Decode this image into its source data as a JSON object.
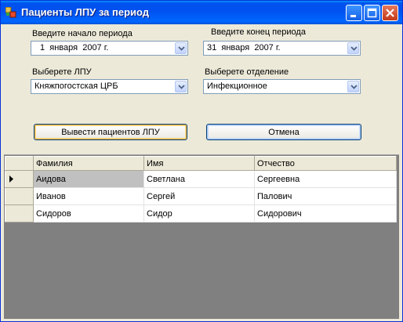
{
  "window": {
    "title": "Пациенты ЛПУ за период"
  },
  "form": {
    "start_label": "Введите начало периода",
    "start_day": "1",
    "start_month": "января",
    "start_year": "2007 г.",
    "end_label": "Введите конец периода",
    "end_day": "31",
    "end_month": "января",
    "end_year": "2007 г.",
    "lpu_label": "Выберете ЛПУ",
    "lpu_value": "Княжпогостская ЦРБ",
    "dept_label": "Выберете отделение",
    "dept_value": "Инфекционное",
    "submit_label": "Вывести пациентов ЛПУ",
    "cancel_label": "Отмена"
  },
  "grid": {
    "columns": [
      "Фамилия",
      "Имя",
      "Отчество"
    ],
    "rows": [
      [
        "Аидова",
        "Светлана",
        "Сергеевна"
      ],
      [
        "Иванов",
        "Сергей",
        "Палович"
      ],
      [
        "Сидоров",
        "Сидор",
        "Сидорович"
      ]
    ]
  }
}
